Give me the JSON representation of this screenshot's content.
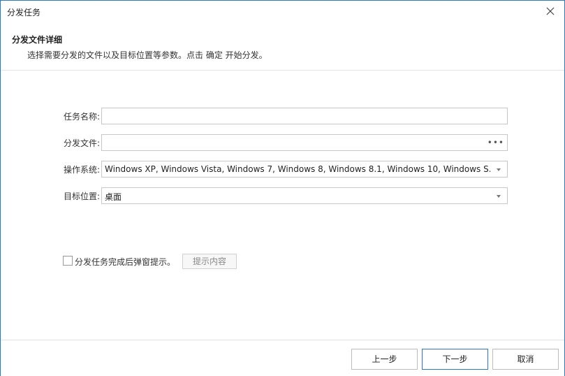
{
  "window": {
    "title": "分发任务",
    "close_icon": "close-icon"
  },
  "header": {
    "title": "分发文件详细",
    "description": "选择需要分发的文件以及目标位置等参数。点击 确定 开始分发。"
  },
  "form": {
    "task_name": {
      "label": "任务名称:",
      "value": ""
    },
    "file": {
      "label": "分发文件:",
      "value": "",
      "browse_icon": "ellipsis-icon",
      "browse_label": "•••"
    },
    "os": {
      "label": "操作系统:",
      "value": "Windows XP, Windows Vista, Windows 7, Windows 8, Windows 8.1, Windows 10, Windows S..."
    },
    "target": {
      "label": "目标位置:",
      "value": "桌面"
    }
  },
  "notify": {
    "checked": false,
    "label": "分发任务完成后弹窗提示。",
    "tip_button": "提示内容"
  },
  "footer": {
    "prev_label": "上一步",
    "next_label": "下一步",
    "cancel_label": "取消"
  },
  "colors": {
    "accent": "#2b79c2",
    "border": "#c8c8c8"
  }
}
